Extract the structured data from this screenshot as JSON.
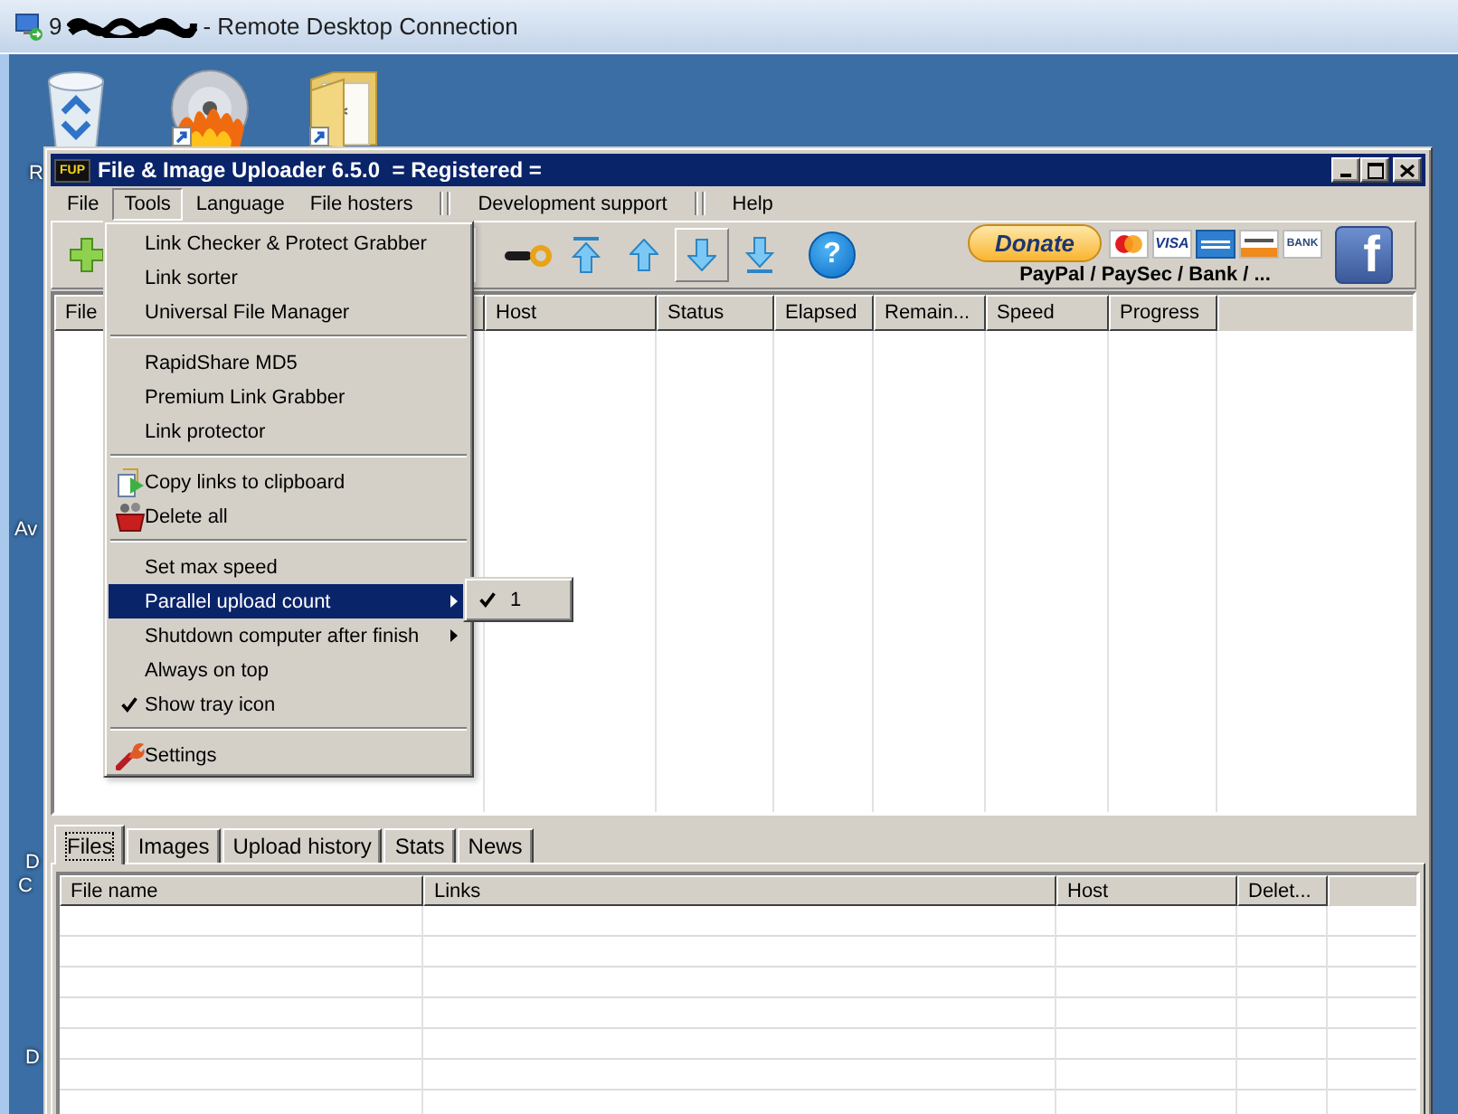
{
  "remote_desktop": {
    "host_prefix": "9",
    "title": "- Remote Desktop Connection"
  },
  "desktop": {
    "icons": [
      {
        "kind": "recycle_bin",
        "shortcut": false,
        "label": "R"
      },
      {
        "kind": "disc",
        "shortcut": true
      },
      {
        "kind": "folder",
        "shortcut": true
      }
    ],
    "edge_labels": [
      "Av",
      "D",
      "C",
      "D"
    ]
  },
  "window": {
    "icon_label": "FUP",
    "title": "File & Image Uploader 6.5.0  = Registered ="
  },
  "menubar": {
    "groups": [
      [
        {
          "label": "File",
          "selected": false
        },
        {
          "label": "Tools",
          "selected": true
        },
        {
          "label": "Language",
          "selected": false
        },
        {
          "label": "File hosters",
          "selected": false
        }
      ],
      [
        {
          "label": "Development support",
          "selected": false
        }
      ],
      [
        {
          "label": "Help",
          "selected": false
        }
      ]
    ]
  },
  "toolbar": {
    "buttons": [
      {
        "kind": "add",
        "hot": false
      },
      {
        "kind": "key",
        "hot": false
      },
      {
        "kind": "top",
        "hot": false
      },
      {
        "kind": "up",
        "hot": false
      },
      {
        "kind": "down",
        "hot": true
      },
      {
        "kind": "bottom",
        "hot": false
      },
      {
        "kind": "help",
        "hot": false,
        "label": "?"
      }
    ],
    "donate": {
      "label": "Donate"
    },
    "payment_marks": [
      {
        "kind": "mastercard"
      },
      {
        "kind": "visa",
        "label": "VISA"
      },
      {
        "kind": "amex"
      },
      {
        "kind": "discover"
      },
      {
        "kind": "bank",
        "label": "BANK"
      }
    ],
    "payment_caption": "PayPal / PaySec / Bank / ...",
    "social": {
      "label": "f"
    }
  },
  "upper_table": {
    "columns": [
      {
        "label": "File"
      },
      {
        "label": "Host"
      },
      {
        "label": "Status"
      },
      {
        "label": "Elapsed"
      },
      {
        "label": "Remain..."
      },
      {
        "label": "Speed"
      },
      {
        "label": "Progress"
      }
    ]
  },
  "bottom_tabs": [
    {
      "label": "Files",
      "selected": true
    },
    {
      "label": "Images",
      "selected": false
    },
    {
      "label": "Upload history",
      "selected": false
    },
    {
      "label": "Stats",
      "selected": false
    },
    {
      "label": "News",
      "selected": false
    }
  ],
  "lower_table": {
    "columns": [
      {
        "label": "File name"
      },
      {
        "label": "Links"
      },
      {
        "label": "Host"
      },
      {
        "label": "Delet..."
      }
    ]
  },
  "tools_menu": {
    "groups": [
      [
        {
          "label": "Link Checker & Protect Grabber",
          "kind": "plain",
          "checked": false,
          "selected": false,
          "has_submenu": false
        },
        {
          "label": "Link sorter",
          "kind": "plain",
          "checked": false,
          "selected": false,
          "has_submenu": false
        },
        {
          "label": "Universal File Manager",
          "kind": "plain",
          "checked": false,
          "selected": false,
          "has_submenu": false
        }
      ],
      [
        {
          "label": "RapidShare MD5",
          "kind": "plain",
          "checked": false,
          "selected": false,
          "has_submenu": false
        },
        {
          "label": "Premium Link Grabber",
          "kind": "plain",
          "checked": false,
          "selected": false,
          "has_submenu": false
        },
        {
          "label": "Link protector",
          "kind": "plain",
          "checked": false,
          "selected": false,
          "has_submenu": false
        }
      ],
      [
        {
          "label": "Copy links to clipboard",
          "kind": "copy",
          "checked": false,
          "selected": false,
          "has_submenu": false
        },
        {
          "label": "Delete all",
          "kind": "delete",
          "checked": false,
          "selected": false,
          "has_submenu": false
        }
      ],
      [
        {
          "label": "Set max speed",
          "kind": "plain",
          "checked": false,
          "selected": false,
          "has_submenu": false
        },
        {
          "label": "Parallel upload count",
          "kind": "plain",
          "checked": false,
          "selected": true,
          "has_submenu": true
        },
        {
          "label": "Shutdown computer after finish",
          "kind": "plain",
          "checked": false,
          "selected": false,
          "has_submenu": true
        },
        {
          "label": "Always on top",
          "kind": "plain",
          "checked": false,
          "selected": false,
          "has_submenu": false
        },
        {
          "label": "Show tray icon",
          "kind": "plain",
          "checked": true,
          "selected": false,
          "has_submenu": false
        }
      ],
      [
        {
          "label": "Settings",
          "kind": "settings",
          "checked": false,
          "selected": false,
          "has_submenu": false
        }
      ]
    ],
    "submenu": {
      "items": [
        {
          "label": "1",
          "checked": true
        }
      ]
    }
  }
}
